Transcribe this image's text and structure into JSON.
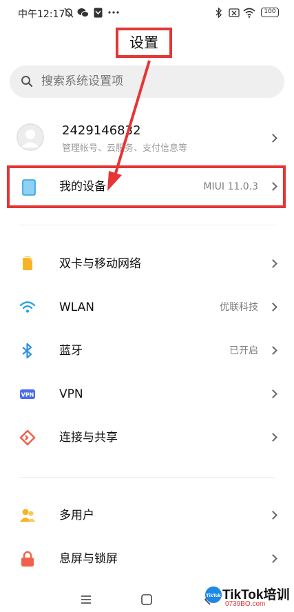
{
  "status_bar": {
    "time": "中午12:17",
    "battery": "100",
    "left_icons": [
      "mute-bell-icon",
      "wechat-icon",
      "sim-icon",
      "more-dots-icon"
    ],
    "right_icons": [
      "bluetooth-icon",
      "no-sim-icon",
      "wifi-icon",
      "battery-icon"
    ]
  },
  "annotation": {
    "title": "设置"
  },
  "search": {
    "placeholder": "搜索系统设置项"
  },
  "account": {
    "name": "2429146832",
    "subtitle": "管理帐号、云服务、支付信息等"
  },
  "device_row": {
    "label": "我的设备",
    "value": "MIUI 11.0.3",
    "icon": "phone-icon"
  },
  "settings": [
    {
      "label": "双卡与移动网络",
      "value": "",
      "icon": "sim-card-icon",
      "color": "#f6b425"
    },
    {
      "label": "WLAN",
      "value": "优联科技",
      "icon": "wifi-icon",
      "color": "#29a3e6"
    },
    {
      "label": "蓝牙",
      "value": "已开启",
      "icon": "bluetooth-icon",
      "color": "#2f8fe8"
    },
    {
      "label": "VPN",
      "value": "",
      "icon": "vpn-icon",
      "color": "#4a6cf0"
    },
    {
      "label": "连接与共享",
      "value": "",
      "icon": "connection-share-icon",
      "color": "#f2604c"
    }
  ],
  "settings2": [
    {
      "label": "多用户",
      "value": "",
      "icon": "multi-user-icon",
      "color": "#f6b425"
    },
    {
      "label": "息屏与锁屏",
      "value": "",
      "icon": "lock-icon",
      "color": "#f2604c"
    }
  ],
  "vpn_badge": "VPN",
  "watermark": {
    "text": "TikTok培训",
    "sub": "0739BO.com",
    "badge": "TikTok"
  },
  "navbar": {
    "icons": [
      "menu-icon",
      "home-icon",
      "back-icon"
    ]
  }
}
